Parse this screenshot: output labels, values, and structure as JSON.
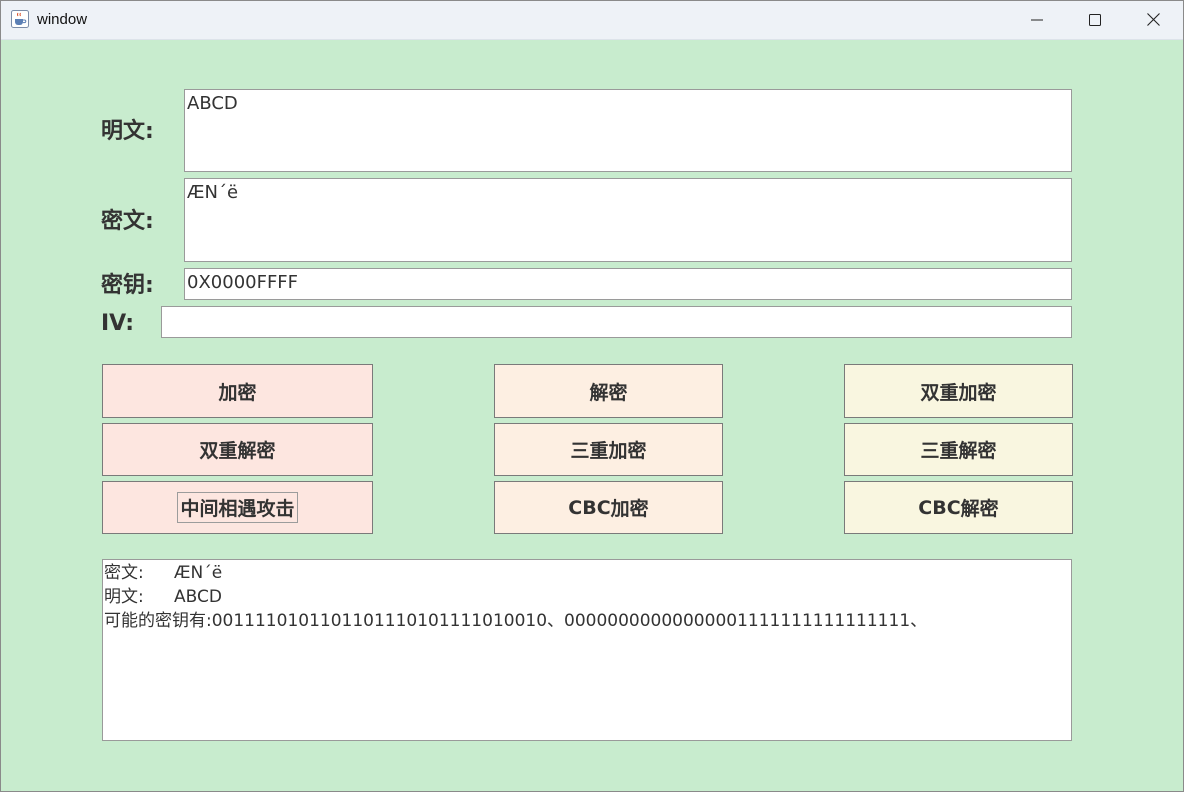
{
  "window": {
    "title": "window"
  },
  "icons": {
    "app": "java-cup-icon",
    "minimize": "minimize-icon",
    "maximize": "maximize-icon",
    "close": "close-icon"
  },
  "form": {
    "plaintext_label": "明文:",
    "plaintext_value": "ABCD",
    "ciphertext_label": "密文:",
    "ciphertext_value": "ÆN´ë",
    "key_label": "密钥:",
    "key_value": "0X0000FFFF",
    "iv_label": "IV:",
    "iv_value": ""
  },
  "buttons": {
    "encrypt": "加密",
    "decrypt": "解密",
    "double_encrypt": "双重加密",
    "double_decrypt": "双重解密",
    "triple_encrypt": "三重加密",
    "triple_decrypt": "三重解密",
    "mitm_attack": "中间相遇攻击",
    "cbc_encrypt_prefix": "CBC",
    "cbc_encrypt_suffix": "加密",
    "cbc_decrypt_prefix": "CBC",
    "cbc_decrypt_suffix": "解密"
  },
  "output": {
    "line1_key": "密文:",
    "line1_value": "ÆN´ë",
    "line2_key": "明文:",
    "line2_value": "ABCD",
    "line3": "可能的密钥有:0011110101101101110101111010010、00000000000000001111111111111111、"
  },
  "colors": {
    "background": "#c8ecce",
    "button_col1": "#fde6e0",
    "button_col2": "#fdefe2",
    "button_col3": "#f9f6e0"
  }
}
